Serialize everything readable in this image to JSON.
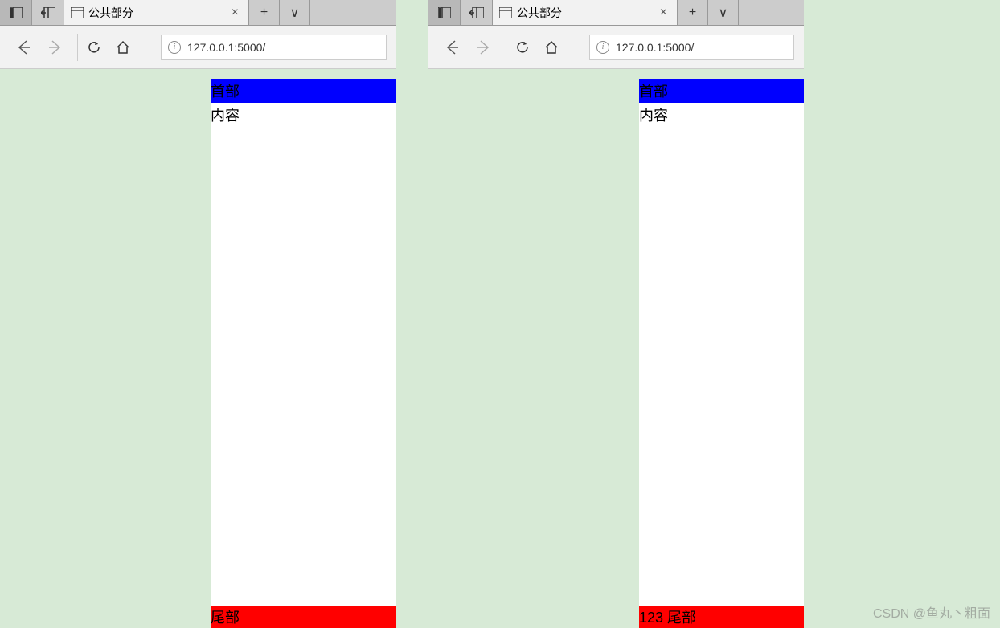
{
  "windows": [
    {
      "tab_title": "公共部分",
      "url": "127.0.0.1:5000/",
      "page": {
        "header": "首部",
        "content": "内容",
        "footer": "尾部"
      }
    },
    {
      "tab_title": "公共部分",
      "url": "127.0.0.1:5000/",
      "page": {
        "header": "首部",
        "content": "内容",
        "footer": "123 尾部"
      }
    }
  ],
  "icons": {
    "new_tab": "+",
    "dropdown": "∨",
    "close": "×",
    "info": "i"
  },
  "watermark": "CSDN @鱼丸丶粗面"
}
